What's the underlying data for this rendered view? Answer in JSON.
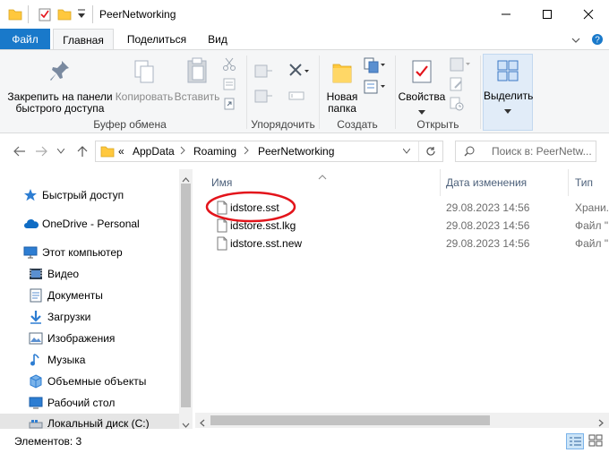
{
  "window": {
    "title": "PeerNetworking"
  },
  "tabs": {
    "file": "Файл",
    "home": "Главная",
    "share": "Поделиться",
    "view": "Вид"
  },
  "ribbon": {
    "pin_line1": "Закрепить на панели",
    "pin_line2": "быстрого доступа",
    "copy": "Копировать",
    "paste": "Вставить",
    "clipboard_group": "Буфер обмена",
    "organize_group": "Упорядочить",
    "new_folder_line1": "Новая",
    "new_folder_line2": "папка",
    "create_group": "Создать",
    "properties": "Свойства",
    "open_group": "Открыть",
    "select": "Выделить"
  },
  "address": {
    "prefix": "«",
    "crumbs": [
      "AppData",
      "Roaming",
      "PeerNetworking"
    ],
    "search_placeholder": "Поиск в: PeerNetw..."
  },
  "nav": {
    "items": [
      {
        "label": "Быстрый доступ"
      },
      {
        "label": "OneDrive - Personal"
      },
      {
        "label": "Этот компьютер"
      },
      {
        "label": "Видео"
      },
      {
        "label": "Документы"
      },
      {
        "label": "Загрузки"
      },
      {
        "label": "Изображения"
      },
      {
        "label": "Музыка"
      },
      {
        "label": "Объемные объекты"
      },
      {
        "label": "Рабочий стол"
      },
      {
        "label": "Локальный диск (C:)"
      }
    ]
  },
  "files": {
    "columns": {
      "name": "Имя",
      "date": "Дата изменения",
      "type": "Тип"
    },
    "rows": [
      {
        "name": "idstore.sst",
        "date": "29.08.2023 14:56",
        "type": "Храни..."
      },
      {
        "name": "idstore.sst.lkg",
        "date": "29.08.2023 14:56",
        "type": "Файл \""
      },
      {
        "name": "idstore.sst.new",
        "date": "29.08.2023 14:56",
        "type": "Файл \""
      }
    ]
  },
  "status": {
    "count": "Элементов: 3"
  },
  "colors": {
    "file_tab": "#1979ca",
    "highlight_ellipse": "#e3141b",
    "folder": "#ffc83d"
  }
}
